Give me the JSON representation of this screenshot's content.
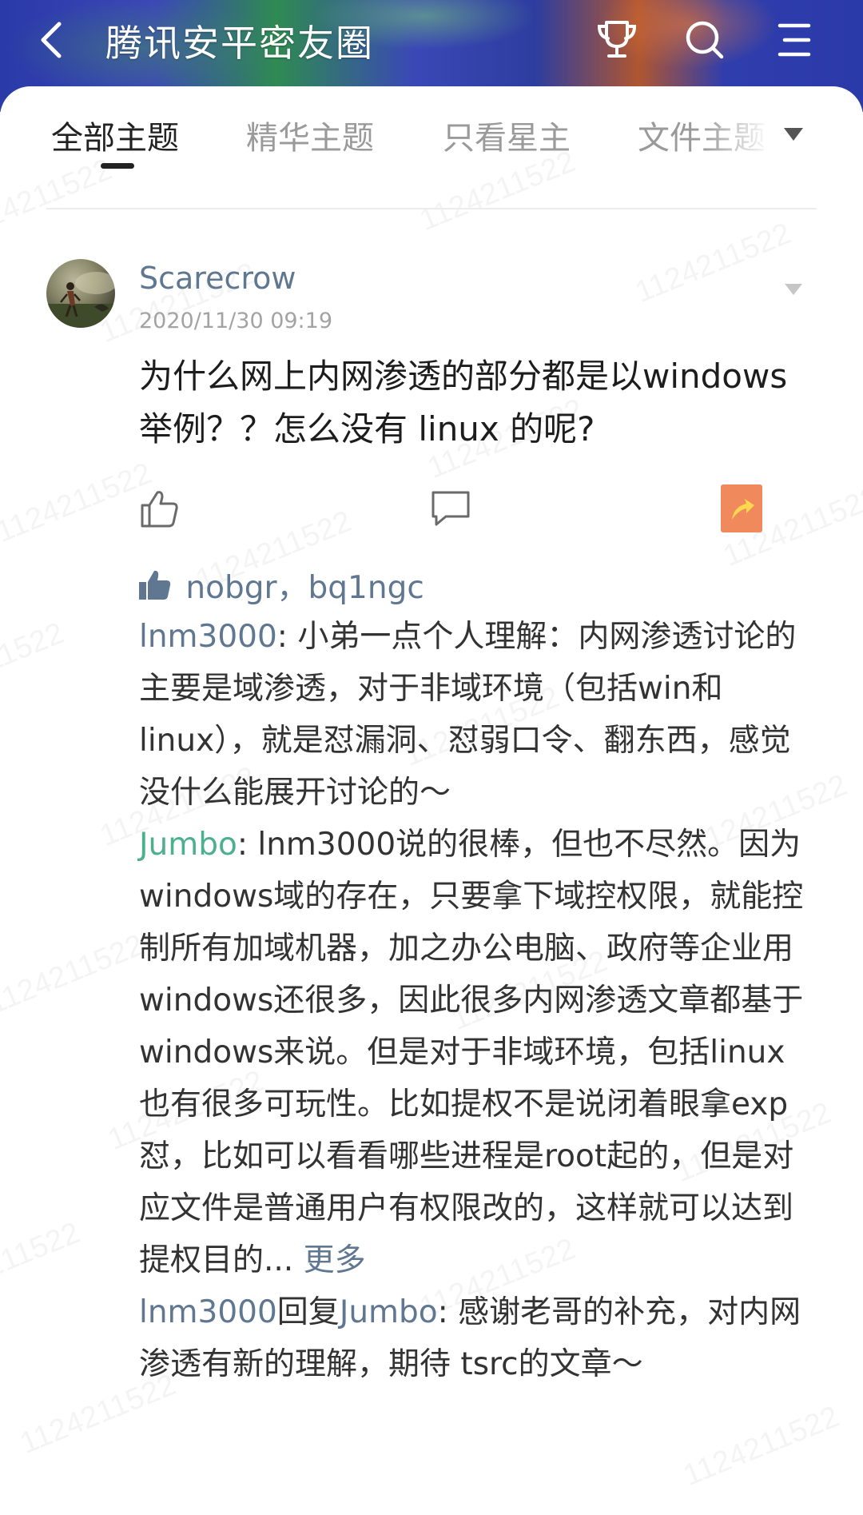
{
  "header": {
    "title": "腾讯安平密友圈"
  },
  "tabs": [
    {
      "label": "全部主题"
    },
    {
      "label": "精华主题"
    },
    {
      "label": "只看星主"
    },
    {
      "label": "文件主题"
    }
  ],
  "watermark_text": "1124211522",
  "post": {
    "author": "Scarecrow",
    "time": "2020/11/30 09:19",
    "text": "为什么网上内网渗透的部分都是以windows举例？？怎么没有 linux 的呢?",
    "likers": [
      "nobgr",
      "bq1ngc"
    ],
    "likers_separator": "，"
  },
  "comments": [
    {
      "author": "lnm3000",
      "text": ": 小弟一点个人理解：内网渗透讨论的主要是域渗透，对于非域环境（包括win和 linux），就是怼漏洞、怼弱口令、翻东西，感觉没什么能展开讨论的～"
    },
    {
      "author": "Jumbo",
      "text": ": lnm3000说的很棒，但也不尽然。因为windows域的存在，只要拿下域控权限，就能控制所有加域机器，加之办公电脑、政府等企业用windows还很多，因此很多内网渗透文章都基于windows来说。但是对于非域环境，包括linux也有很多可玩性。比如提权不是说闭着眼拿exp怼，比如可以看看哪些进程是root起的，但是对应文件是普通用户有权限改的，这样就可以达到提权目的... ",
      "more": "更多"
    },
    {
      "author": "lnm3000",
      "reply_word": "回复",
      "reply_to": "Jumbo",
      "text": ": 感谢老哥的补充，对内网渗透有新的理解，期待 tsrc的文章～"
    }
  ]
}
